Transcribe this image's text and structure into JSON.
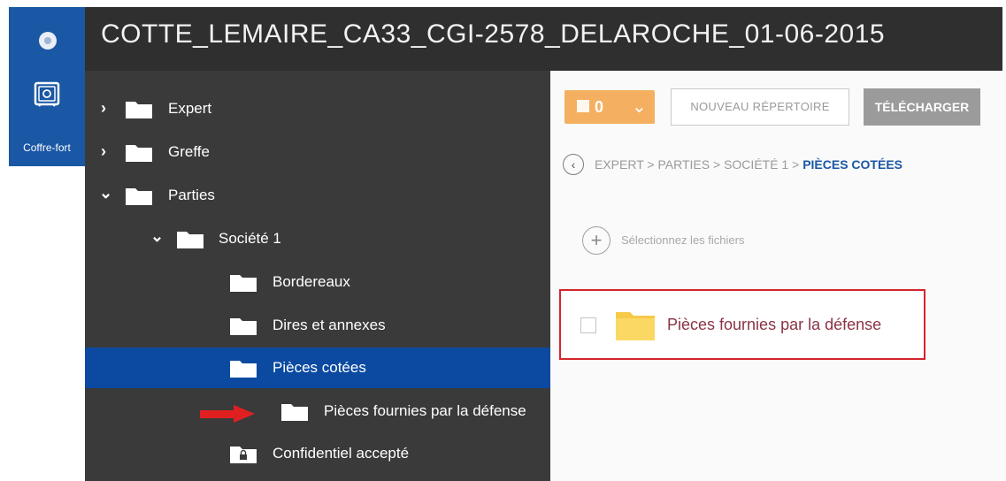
{
  "window": {
    "title": "COTTE_LEMAIRE_CA33_CGI-2578_DELAROCHE_01-06-2015"
  },
  "sidebar": {
    "items": [
      {
        "label": "Coffre-fort",
        "icon": "safe-icon",
        "active": true
      }
    ]
  },
  "tree": {
    "items": [
      {
        "label": "Expert",
        "expanded": false,
        "icon": "folder-icon"
      },
      {
        "label": "Greffe",
        "expanded": false,
        "icon": "folder-icon"
      },
      {
        "label": "Parties",
        "expanded": true,
        "icon": "folder-icon"
      },
      {
        "label": "Société 1",
        "expanded": true,
        "icon": "folder-icon"
      },
      {
        "label": "Bordereaux",
        "icon": "folder-icon"
      },
      {
        "label": "Dires et annexes",
        "icon": "folder-icon"
      },
      {
        "label": "Pièces cotées",
        "selected": true,
        "icon": "folder-icon"
      },
      {
        "label": "Pièces fournies par la défense",
        "icon": "folder-icon",
        "highlight_arrow": true
      },
      {
        "label": "Confidentiel accepté",
        "icon": "locked-folder-icon"
      }
    ]
  },
  "toolbar": {
    "selection_count": "0",
    "new_folder_label": "NOUVEAU RÉPERTOIRE",
    "download_label": "TÉLÉCHARGER"
  },
  "breadcrumb": {
    "items": [
      "EXPERT",
      "PARTIES",
      "SOCIÉTÉ 1"
    ],
    "current": "PIÈCES COTÉES",
    "separator": ">"
  },
  "upload": {
    "label": "Sélectionnez les fichiers"
  },
  "files": [
    {
      "name": "Pièces fournies par la défense",
      "type": "folder",
      "checked": false
    }
  ],
  "colors": {
    "accent": "#1a57a4",
    "titlebar": "#2f2f2f",
    "tree_bg": "#3a3a3a",
    "selected_row": "#0b4aa0",
    "dropdown": "#f4b060",
    "download_button": "#9b9b9b",
    "highlight_border": "#d3242c",
    "arrow": "#e02020"
  }
}
